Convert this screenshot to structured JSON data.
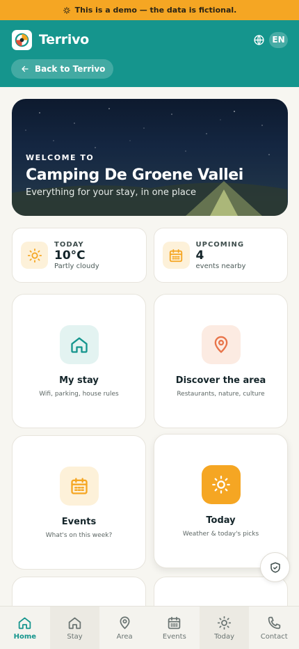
{
  "banner": {
    "text": "This is a demo — the data is fictional."
  },
  "header": {
    "brand": "Terrivo",
    "language": "EN",
    "back_label": "Back to Terrivo"
  },
  "hero": {
    "kicker": "WELCOME TO",
    "title": "Camping De Groene Vallei",
    "subtitle": "Everything for your stay, in one place"
  },
  "stats": [
    {
      "label": "TODAY",
      "value": "10°C",
      "sub": "Partly cloudy",
      "icon": "sun-icon"
    },
    {
      "label": "UPCOMING",
      "value": "4",
      "sub": "events nearby",
      "icon": "calendar-icon"
    }
  ],
  "tiles": [
    {
      "title": "My stay",
      "sub": "Wifi, parking, house rules",
      "icon": "home-icon"
    },
    {
      "title": "Discover the area",
      "sub": "Restaurants, nature, culture",
      "icon": "map-pin-icon"
    },
    {
      "title": "Events",
      "sub": "What's on this week?",
      "icon": "calendar-icon"
    },
    {
      "title": "Today",
      "sub": "Weather & today's picks",
      "icon": "sun-icon"
    }
  ],
  "tabbar": [
    {
      "label": "Home",
      "icon": "home-icon",
      "active": true
    },
    {
      "label": "Stay",
      "icon": "home-icon"
    },
    {
      "label": "Area",
      "icon": "map-pin-icon"
    },
    {
      "label": "Events",
      "icon": "calendar-icon"
    },
    {
      "label": "Today",
      "icon": "sun-icon"
    },
    {
      "label": "Contact",
      "icon": "phone-icon"
    }
  ],
  "colors": {
    "primary": "#15958d",
    "accent": "#f5a623",
    "background": "#f7f6f1"
  }
}
